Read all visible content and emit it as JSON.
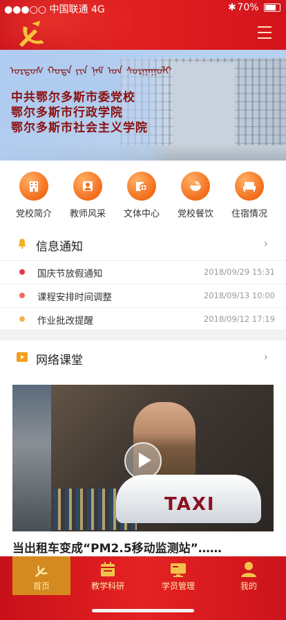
{
  "status": {
    "carrier": "●●●○○ 中国联通 4G",
    "battery": "70%"
  },
  "banner": {
    "mongolian": "ᠣᠷᠳᠣᠰ ᠬᠣᠲᠠ ᠶᠢᠨ ᠨᠠᠮ ᠤᠨ ᠰᠤᠷᠭᠠᠭᠤᠯᠢ",
    "lines": [
      "中共鄂尔多斯市委党校",
      "鄂尔多斯市行政学院",
      "鄂尔多斯市社会主义学院"
    ]
  },
  "categories": [
    {
      "label": "党校简介",
      "icon": "building-icon"
    },
    {
      "label": "教师风采",
      "icon": "teacher-icon"
    },
    {
      "label": "文体中心",
      "icon": "sports-icon"
    },
    {
      "label": "党校餐饮",
      "icon": "bowl-icon"
    },
    {
      "label": "住宿情况",
      "icon": "bed-icon"
    }
  ],
  "notices": {
    "title": "信息通知",
    "items": [
      {
        "text": "国庆节放假通知",
        "date": "2018/09/29  15:31",
        "color": "#e8334a"
      },
      {
        "text": "课程安排时间调整",
        "date": "2018/09/13  10:00",
        "color": "#f06a5a"
      },
      {
        "text": "作业批改提醒",
        "date": "2018/09/12  17:19",
        "color": "#f0b24a"
      }
    ]
  },
  "course": {
    "title": "网络课堂",
    "video_title": "当出租车变成“PM2.5移动监测站”……",
    "taxi_text": "TAXI"
  },
  "tabs": [
    {
      "label": "首页",
      "icon": "party-emblem-icon",
      "active": true
    },
    {
      "label": "教学科研",
      "icon": "calendar-icon"
    },
    {
      "label": "学员管理",
      "icon": "monitor-icon"
    },
    {
      "label": "我的",
      "icon": "person-icon"
    }
  ],
  "colors": {
    "primary": "#d6161e",
    "accent": "#f26d1b",
    "tab_active": "#d48a1f"
  }
}
